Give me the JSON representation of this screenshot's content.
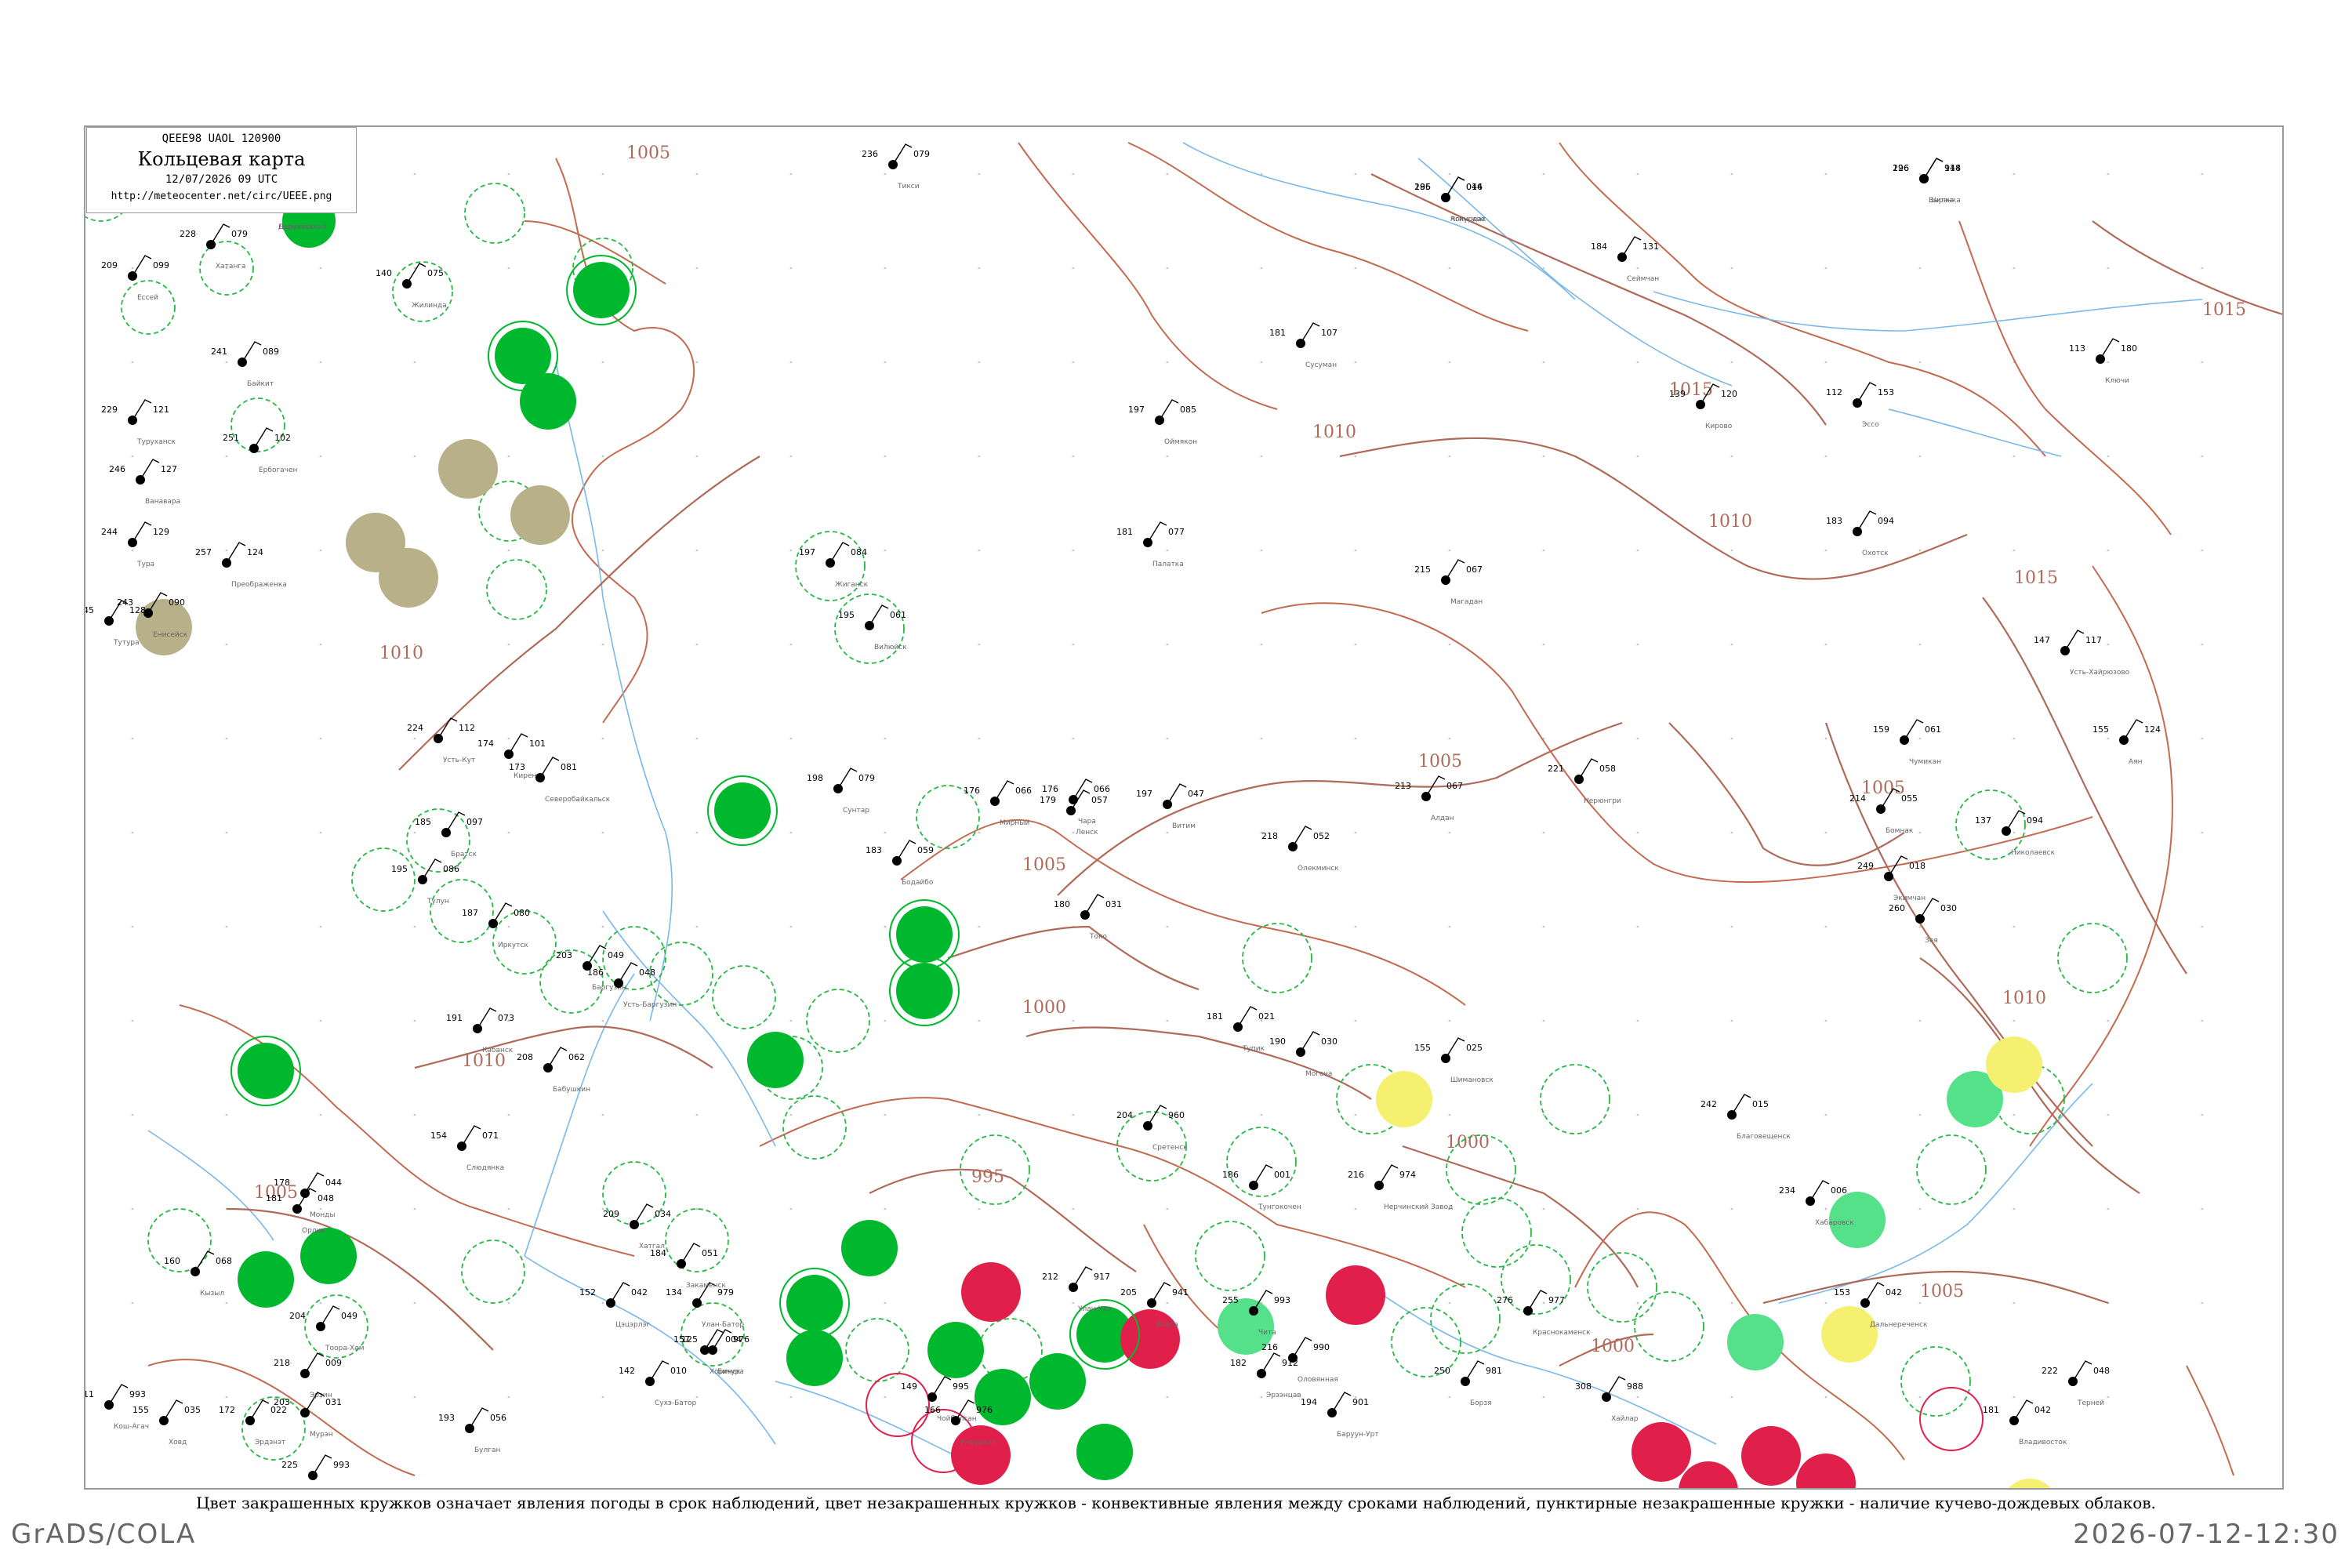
{
  "header": {
    "codes": "QEEE98  UAOL  120900",
    "title": "Кольцевая карта",
    "time": "12/07/2026 09 UTC",
    "url": "http://meteocenter.net/circ/UEEE.png"
  },
  "caption": "Цвет закрашенных кружков означает явления погоды в срок наблюдений, цвет незакрашенных кружков - конвективные явления между сроками наблюдений, пунктирные незакрашенные кружки - наличие кучево-дождевых облаков.",
  "footer": {
    "left": "GrADS/COLA",
    "right": "2026-07-12-12:30"
  },
  "colors": {
    "isobar": "#b06a5a",
    "river": "#7ab8ea",
    "thunder_circle": "#00b82e",
    "thunder_light": "#55e08a",
    "haze": "#b8b088",
    "hail": "#e0204a",
    "yellow": "#f5f070",
    "dashed": "#27b845"
  },
  "isobars": [
    {
      "label": "1015"
    },
    {
      "label": "1015"
    },
    {
      "label": "1010"
    },
    {
      "label": "1010"
    },
    {
      "label": "1015"
    },
    {
      "label": "1010"
    },
    {
      "label": "1005"
    },
    {
      "label": "1005"
    },
    {
      "label": "1005"
    },
    {
      "label": "1000"
    },
    {
      "label": "1000"
    },
    {
      "label": "995"
    },
    {
      "label": "1010"
    },
    {
      "label": "1005"
    },
    {
      "label": "1010"
    },
    {
      "label": "1005"
    },
    {
      "label": "1000"
    },
    {
      "label": "1005"
    }
  ],
  "stations": [
    {
      "t": "186",
      "p": "046",
      "name": "Чокурдах"
    },
    {
      "t": "174",
      "p": "073",
      "name": "Депутатский"
    },
    {
      "t": "226",
      "p": "114",
      "name": "Зырянка"
    },
    {
      "t": "184",
      "p": "131",
      "name": "Сеймчан"
    },
    {
      "t": "181",
      "p": "107",
      "name": "Сусуман"
    },
    {
      "t": "197",
      "p": "085",
      "name": "Оймякон"
    },
    {
      "t": "181",
      "p": "077",
      "name": "Палатка"
    },
    {
      "t": "215",
      "p": "067",
      "name": "Магадан"
    },
    {
      "t": "139",
      "p": "120",
      "name": "Кирово"
    },
    {
      "t": "112",
      "p": "153",
      "name": "Эссо"
    },
    {
      "t": "113",
      "p": "180",
      "name": "Ключи"
    },
    {
      "t": "183",
      "p": "094",
      "name": "Охотск"
    },
    {
      "t": "147",
      "p": "117",
      "name": "Усть-Хайрюзово"
    },
    {
      "t": "155",
      "p": "124",
      "name": "Аян"
    },
    {
      "t": "137",
      "p": "094",
      "name": "Николаевск"
    },
    {
      "t": "159",
      "p": "061",
      "name": "Чумикан"
    },
    {
      "t": "214",
      "p": "055",
      "name": "Бомнак"
    },
    {
      "t": "249",
      "p": "018",
      "name": "Экимчан"
    },
    {
      "t": "260",
      "p": "030",
      "name": "Зея"
    },
    {
      "t": "221",
      "p": "058",
      "name": "Нерюнгри"
    },
    {
      "t": "218",
      "p": "052",
      "name": "Олекминск"
    },
    {
      "t": "213",
      "p": "067",
      "name": "Алдан"
    },
    {
      "t": "197",
      "p": "047",
      "name": "Витим"
    },
    {
      "t": "179",
      "p": "057",
      "name": "Ленск"
    },
    {
      "t": "180",
      "p": "031",
      "name": "Токо"
    },
    {
      "t": "176",
      "p": "066",
      "name": "Чара"
    },
    {
      "t": "183",
      "p": "059",
      "name": "Бодайбо"
    },
    {
      "t": "181",
      "p": "021",
      "name": "Тупик"
    },
    {
      "t": "190",
      "p": "030",
      "name": "Могоча"
    },
    {
      "t": "155",
      "p": "025",
      "name": "Шимановск"
    },
    {
      "t": "242",
      "p": "015",
      "name": "Благовещенск"
    },
    {
      "t": "234",
      "p": "006",
      "name": "Хабаровск"
    },
    {
      "t": "153",
      "p": "042",
      "name": "Дальнереченск"
    },
    {
      "t": "181",
      "p": "042",
      "name": "Владивосток"
    },
    {
      "t": "222",
      "p": "048",
      "name": "Терней"
    },
    {
      "t": "216",
      "p": "974",
      "name": "Нерчинский Завод"
    },
    {
      "t": "255",
      "p": "993",
      "name": "Чита"
    },
    {
      "t": "204",
      "p": "960",
      "name": "Сретенск"
    },
    {
      "t": "186",
      "p": "001",
      "name": "Тунгокочен"
    },
    {
      "t": "197",
      "p": "084",
      "name": "Жиганск"
    },
    {
      "t": "195",
      "p": "061",
      "name": "Вилюйск"
    },
    {
      "t": "198",
      "p": "079",
      "name": "Сунтар"
    },
    {
      "t": "176",
      "p": "066",
      "name": "Мирный"
    },
    {
      "t": "212",
      "p": "917",
      "name": "Улан-Удэ"
    },
    {
      "t": "205",
      "p": "941",
      "name": "Кяхта"
    },
    {
      "t": "250",
      "p": "981",
      "name": "Борзя"
    },
    {
      "t": "276",
      "p": "977",
      "name": "Краснокаменск"
    },
    {
      "t": "308",
      "p": "988",
      "name": "Хайлар"
    },
    {
      "t": "243",
      "p": "090",
      "name": "Енисейск"
    },
    {
      "t": "229",
      "p": "121",
      "name": "Туруханск"
    },
    {
      "t": "246",
      "p": "127",
      "name": "Ванавара"
    },
    {
      "t": "244",
      "p": "129",
      "name": "Тура"
    },
    {
      "t": "251",
      "p": "102",
      "name": "Ербогачен"
    },
    {
      "t": "257",
      "p": "124",
      "name": "Преображенка"
    },
    {
      "t": "245",
      "p": "128",
      "name": "Тутура"
    },
    {
      "t": "241",
      "p": "089",
      "name": "Байкит"
    },
    {
      "t": "209",
      "p": "099",
      "name": "Ессей"
    },
    {
      "t": "228",
      "p": "079",
      "name": "Хатанга"
    },
    {
      "t": "140",
      "p": "075",
      "name": "Жилинда"
    },
    {
      "t": "236",
      "p": "079",
      "name": "Тикси"
    },
    {
      "t": "224",
      "p": "112",
      "name": "Усть-Кут"
    },
    {
      "t": "174",
      "p": "101",
      "name": "Киренск"
    },
    {
      "t": "173",
      "p": "081",
      "name": "Северобайкальск"
    },
    {
      "t": "185",
      "p": "097",
      "name": "Братск"
    },
    {
      "t": "195",
      "p": "086",
      "name": "Тулун"
    },
    {
      "t": "187",
      "p": "080",
      "name": "Иркутск"
    },
    {
      "t": "203",
      "p": "049",
      "name": "Баргузин"
    },
    {
      "t": "186",
      "p": "048",
      "name": "Усть-Баргузин"
    },
    {
      "t": "191",
      "p": "073",
      "name": "Кабанск"
    },
    {
      "t": "208",
      "p": "062",
      "name": "Бабушкин"
    },
    {
      "t": "154",
      "p": "071",
      "name": "Слюдянка"
    },
    {
      "t": "178",
      "p": "044",
      "name": "Монды"
    },
    {
      "t": "181",
      "p": "048",
      "name": "Орлик"
    },
    {
      "t": "160",
      "p": "068",
      "name": "Кызыл"
    },
    {
      "t": "204",
      "p": "049",
      "name": "Тоора-Хем"
    },
    {
      "t": "218",
      "p": "009",
      "name": "Эрзин"
    },
    {
      "t": "203",
      "p": "031",
      "name": "Мурэн"
    },
    {
      "t": "225",
      "p": "993",
      "name": "Улгий"
    },
    {
      "t": "193",
      "p": "056",
      "name": "Булган"
    },
    {
      "t": "211",
      "p": "993",
      "name": "Кош-Агач"
    },
    {
      "t": "155",
      "p": "035",
      "name": "Ховд"
    },
    {
      "t": "172",
      "p": "022",
      "name": "Эрдэнэт"
    },
    {
      "t": "142",
      "p": "010",
      "name": "Сухэ-Батор"
    },
    {
      "t": "134",
      "p": "979",
      "name": "Улан-Батор"
    },
    {
      "t": "152",
      "p": "042",
      "name": "Цэцэрлэг"
    },
    {
      "t": "209",
      "p": "034",
      "name": "Хатгал"
    },
    {
      "t": "184",
      "p": "051",
      "name": "Закаменск"
    },
    {
      "t": "157",
      "p": "004",
      "name": "Хоринск"
    },
    {
      "t": "125",
      "p": "976",
      "name": "Бичура"
    },
    {
      "t": "149",
      "p": "995",
      "name": "Чойбалсан"
    },
    {
      "t": "166",
      "p": "976",
      "name": "Ундурхан"
    },
    {
      "t": "194",
      "p": "901",
      "name": "Баруун-Урт"
    },
    {
      "t": "182",
      "p": "912",
      "name": "Эрээнцав"
    },
    {
      "t": "216",
      "p": "990",
      "name": "Оловянная"
    },
    {
      "t": "295",
      "p": "014",
      "name": "Агинское"
    },
    {
      "t": "255",
      "p": "976",
      "name": "Нерчинск"
    },
    {
      "t": "196",
      "p": "948",
      "name": "Шилка"
    }
  ]
}
